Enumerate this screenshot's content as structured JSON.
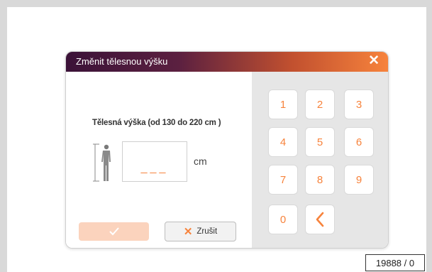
{
  "dialog": {
    "title": "Změnit tělesnou výšku",
    "close_glyph": "✕",
    "field_label": "Tělesná výška (od 130 do 220 cm )",
    "input_value": "___",
    "unit": "cm",
    "ok_icon": "check-icon",
    "cancel_icon": "close-icon",
    "cancel_glyph": "✕",
    "cancel_label": "Zrušit"
  },
  "keypad": {
    "keys": [
      "1",
      "2",
      "3",
      "4",
      "5",
      "6",
      "7",
      "8",
      "9",
      "0"
    ],
    "backspace_icon": "chevron-left-icon"
  },
  "counter": "19888 / 0",
  "colors": {
    "accent": "#f7833c",
    "title_gradient_start": "#3b1238",
    "title_gradient_end": "#f7833c",
    "keypad_bg": "#e6e6e6",
    "ok_disabled": "#fbd3bd"
  }
}
